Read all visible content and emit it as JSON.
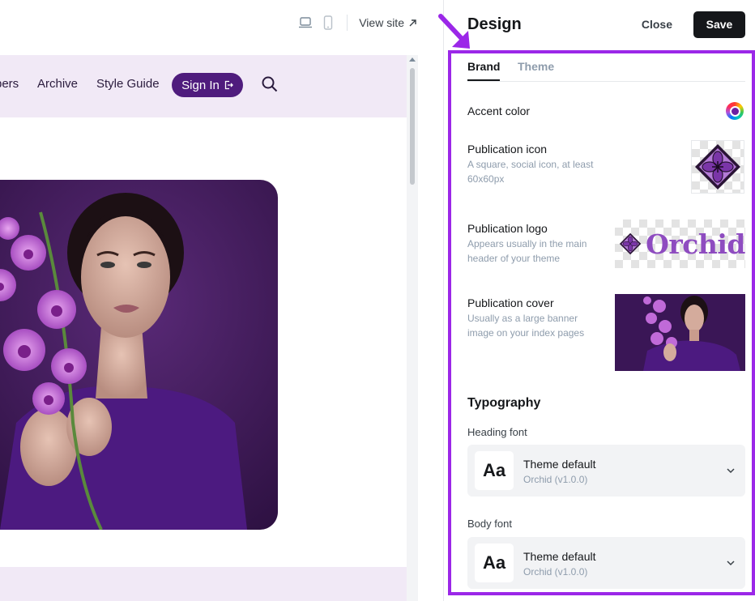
{
  "preview": {
    "view_site": "View site",
    "nav": [
      "pers",
      "Archive",
      "Style Guide"
    ],
    "signin": "Sign In"
  },
  "panel": {
    "title": "Design",
    "close": "Close",
    "save": "Save",
    "tabs": [
      {
        "label": "Brand",
        "active": true
      },
      {
        "label": "Theme",
        "active": false
      }
    ],
    "accent": {
      "label": "Accent color",
      "color": "#6b1fa2"
    },
    "pub_icon": {
      "label": "Publication icon",
      "desc": "A square, social icon, at least 60x60px"
    },
    "pub_logo": {
      "label": "Publication logo",
      "desc": "Appears usually in the main header of your theme",
      "text": "Orchid"
    },
    "pub_cover": {
      "label": "Publication cover",
      "desc": "Usually as a large banner image on your index pages"
    },
    "typography": {
      "title": "Typography",
      "heading": {
        "label": "Heading font",
        "aa": "Aa",
        "name": "Theme default",
        "sub": "Orchid (v1.0.0)"
      },
      "body": {
        "label": "Body font",
        "aa": "Aa",
        "name": "Theme default",
        "sub": "Orchid (v1.0.0)"
      }
    }
  },
  "colors": {
    "highlight": "#9b27e8",
    "brand_purple": "#4f1c7d",
    "nav_bg": "#f1e9f6"
  }
}
